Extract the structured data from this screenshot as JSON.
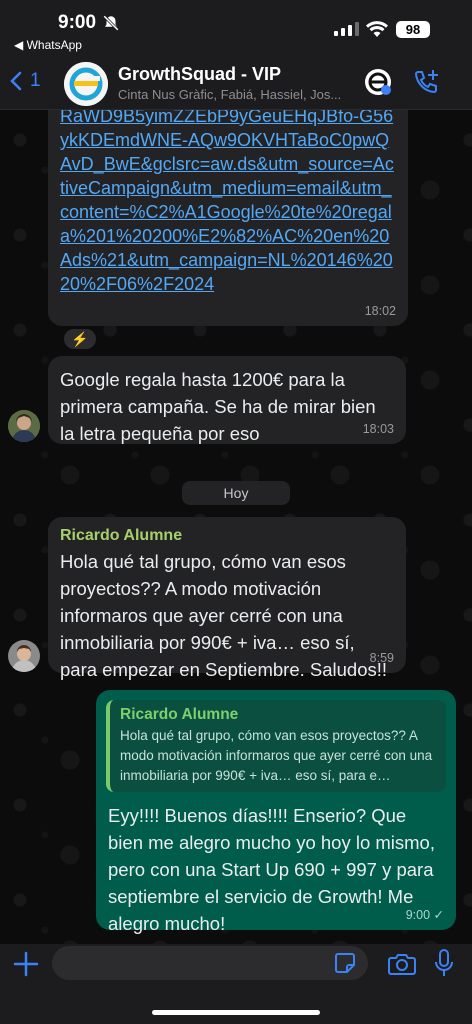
{
  "status_bar": {
    "time": "9:00",
    "back_app": "◀ WhatsApp",
    "battery": "98"
  },
  "header": {
    "back_count": "1",
    "title": "GrowthSquad - VIP",
    "members": "Cinta Nus Gràfic, Fabiá, Hassiel, Jos..."
  },
  "messages": [
    {
      "type": "link",
      "text": "RaWD9B5yimZZEbP9yGeuEHqJBfo-G56ykKDEmdWNE-AQw9OKVHTaBoC0pwQAvD_BwE&gclsrc=aw.ds&utm_source=ActiveCampaign&utm_medium=email&utm_content=%C2%A1Google%20te%20regala%201%20200%E2%82%AC%20en%20Ads%21&utm_campaign=NL%20146%2020%2F06%2F2024",
      "time": "18:02",
      "reaction": "⚡"
    },
    {
      "type": "text",
      "text": "Google regala hasta 1200€ para la primera campaña. Se ha de mirar bien la letra pequeña por eso",
      "time": "18:03"
    },
    {
      "type": "incoming",
      "sender": "Ricardo Alumne",
      "text": "Hola qué tal grupo, cómo van esos proyectos?? A modo motivación informaros que ayer cerré con una inmobiliaria por 990€ + iva… eso sí, para empezar en Septiembre. Saludos!!",
      "time": "8:59"
    },
    {
      "type": "outgoing",
      "quote_sender": "Ricardo Alumne",
      "quote_text": "Hola qué tal grupo, cómo van esos proyectos?? A modo motivación informaros que ayer cerré con una inmobiliaria por 990€ + iva… eso sí, para e…",
      "text": "Eyy!!!! Buenos días!!!! Enserio? Que bien me alegro mucho yo hoy lo mismo, pero con una Start Up 690 + 997 y para septiembre el servicio de Growth! Me alegro mucho!",
      "time": "9:00",
      "status": "✓"
    }
  ],
  "date_divider": "Hoy",
  "composer": {
    "placeholder": ""
  },
  "colors": {
    "accent": "#3b82f6",
    "outgoing_bubble": "#005c4b",
    "incoming_bubble": "#232325",
    "sender_name": "#a8d06a"
  },
  "icons": [
    "bell-slash-icon",
    "signal-icon",
    "wifi-icon",
    "back-chevron-icon",
    "group-logo-icon",
    "add-call-icon",
    "plus-icon",
    "sticker-icon",
    "camera-icon",
    "mic-icon",
    "double-check-icon"
  ]
}
